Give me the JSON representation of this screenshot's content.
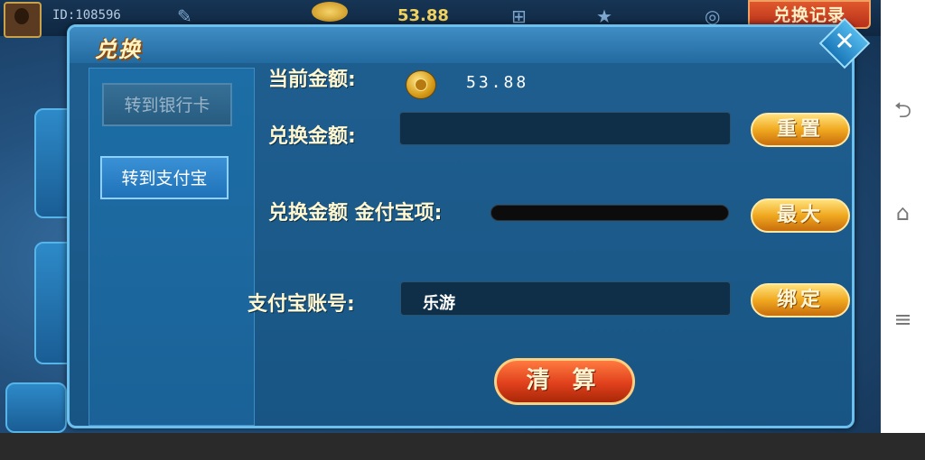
{
  "topbar": {
    "user_id": "ID:108596",
    "balance": "53.88",
    "history_button": "兑换记录"
  },
  "dialog": {
    "title": "兑换",
    "tabs": [
      {
        "label": "转到银行卡",
        "selected": false
      },
      {
        "label": "转到支付宝",
        "selected": true
      }
    ],
    "current_amount_label": "当前金额:",
    "current_amount_value": "53.88",
    "exchange_amount_label": "兑换金额:",
    "exchange_amount_value": "",
    "reset_button": "重置",
    "slider_label": "兑换金额 金付宝项:",
    "slider_value": 0.0,
    "max_button": "最大",
    "alipay_account_label": "支付宝账号:",
    "alipay_account_value": "乐游",
    "bind_button": "绑定",
    "settle_button": "清 算"
  },
  "icons": {
    "close": "close-icon",
    "coin": "gold-coin-icon",
    "nav_back": "back-icon",
    "nav_home": "home-icon",
    "nav_menu": "menu-icon"
  },
  "colors": {
    "accent_gold": "#f0a820",
    "settle_red": "#e0401c",
    "panel_blue": "#1f5f8f"
  }
}
